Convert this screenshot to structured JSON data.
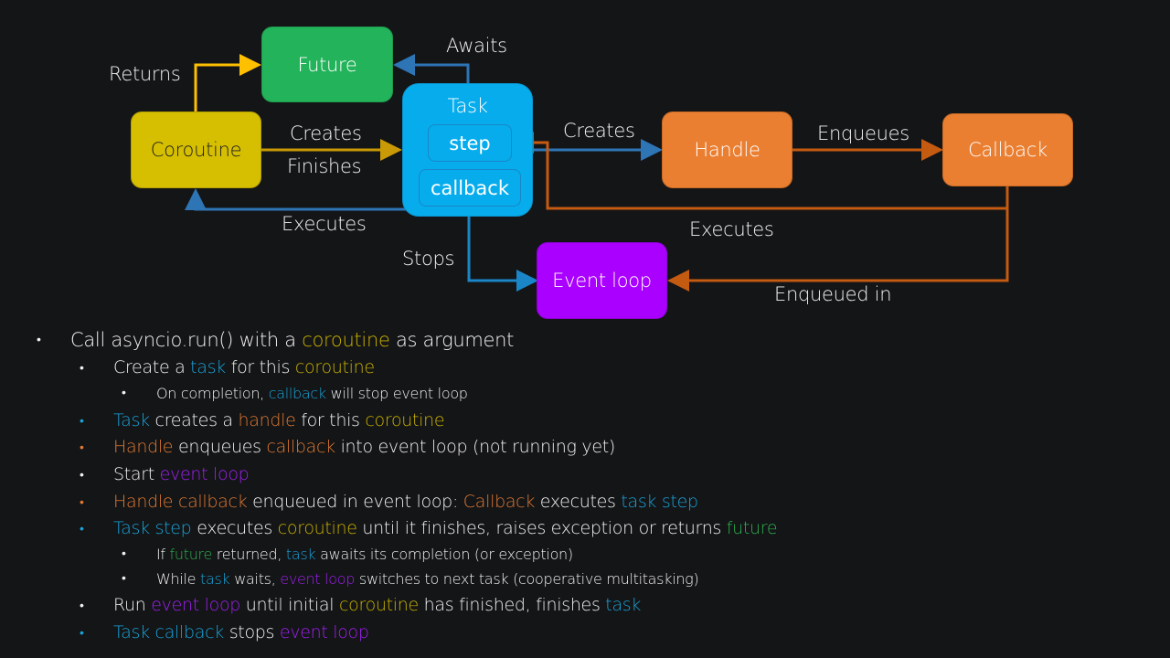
{
  "colors": {
    "coroutine": "#d6bf00",
    "future": "#23b35a",
    "task": "#06acec",
    "handle": "#ea7f31",
    "event_loop": "#aa00ff",
    "arrow_yellow": "#ffc000",
    "arrow_gold": "#c99a06",
    "arrow_blue": "#2e75b6",
    "arrow_orange": "#c55a11",
    "text_coroutine": "#c9b100",
    "text_task": "#1aa3d9",
    "text_handle": "#e07a33",
    "text_event_loop": "#a020f0",
    "text_future": "#2eae4f"
  },
  "nodes": {
    "future": "Future",
    "coroutine": "Coroutine",
    "task": "Task",
    "task_step": "step",
    "task_callback": "callback",
    "handle": "Handle",
    "callback": "Callback",
    "event_loop": "Event loop"
  },
  "edges": {
    "returns": "Returns",
    "awaits": "Awaits",
    "creates_task": "Creates",
    "finishes": "Finishes",
    "executes_coroutine": "Executes",
    "creates_handle": "Creates",
    "enqueues": "Enqueues",
    "executes_step": "Executes",
    "stops": "Stops",
    "enqueued_in": "Enqueued in"
  },
  "bullets": [
    {
      "level": 1,
      "bullet_color": "#f2f2f2",
      "segments": [
        {
          "t": "Call asyncio.run() with a "
        },
        {
          "t": "coroutine",
          "c": "coroutine"
        },
        {
          "t": " as argument"
        }
      ]
    },
    {
      "level": 2,
      "bullet_color": "#f2f2f2",
      "segments": [
        {
          "t": "Create a "
        },
        {
          "t": "task",
          "c": "task"
        },
        {
          "t": " for this "
        },
        {
          "t": "coroutine",
          "c": "coroutine"
        }
      ]
    },
    {
      "level": 3,
      "bullet_color": "#f2f2f2",
      "segments": [
        {
          "t": "On completion, "
        },
        {
          "t": "callback",
          "c": "task"
        },
        {
          "t": " will stop event loop"
        }
      ]
    },
    {
      "level": 2,
      "bullet_color": "#1aa3d9",
      "segments": [
        {
          "t": "Task",
          "c": "task"
        },
        {
          "t": " creates a "
        },
        {
          "t": "handle",
          "c": "handle"
        },
        {
          "t": " for this "
        },
        {
          "t": "coroutine",
          "c": "coroutine"
        }
      ]
    },
    {
      "level": 2,
      "bullet_color": "#e07a33",
      "segments": [
        {
          "t": "Handle",
          "c": "handle"
        },
        {
          "t": " enqueues "
        },
        {
          "t": "callback",
          "c": "handle"
        },
        {
          "t": " into event loop (not running yet)"
        }
      ]
    },
    {
      "level": 2,
      "bullet_color": "#f2f2f2",
      "segments": [
        {
          "t": "Start "
        },
        {
          "t": "event loop",
          "c": "event_loop"
        }
      ]
    },
    {
      "level": 2,
      "bullet_color": "#e07a33",
      "segments": [
        {
          "t": "Handle callback",
          "c": "handle"
        },
        {
          "t": " enqueued in event loop: "
        },
        {
          "t": "Callback",
          "c": "handle"
        },
        {
          "t": " executes "
        },
        {
          "t": "task step",
          "c": "task"
        }
      ]
    },
    {
      "level": 2,
      "bullet_color": "#1aa3d9",
      "segments": [
        {
          "t": "Task step",
          "c": "task"
        },
        {
          "t": " executes "
        },
        {
          "t": "coroutine",
          "c": "coroutine"
        },
        {
          "t": " until it finishes, raises exception or returns "
        },
        {
          "t": "future",
          "c": "future"
        }
      ]
    },
    {
      "level": 3,
      "bullet_color": "#f2f2f2",
      "segments": [
        {
          "t": "If "
        },
        {
          "t": "future",
          "c": "future"
        },
        {
          "t": " returned, "
        },
        {
          "t": "task",
          "c": "task"
        },
        {
          "t": " awaits its completion (or exception)"
        }
      ]
    },
    {
      "level": 3,
      "bullet_color": "#f2f2f2",
      "segments": [
        {
          "t": "While "
        },
        {
          "t": "task",
          "c": "task"
        },
        {
          "t": " waits, "
        },
        {
          "t": "event loop",
          "c": "event_loop"
        },
        {
          "t": " switches to next task (cooperative multitasking)"
        }
      ]
    },
    {
      "level": 2,
      "bullet_color": "#f2f2f2",
      "segments": [
        {
          "t": "Run "
        },
        {
          "t": "event loop",
          "c": "event_loop"
        },
        {
          "t": " until initial "
        },
        {
          "t": "coroutine",
          "c": "coroutine"
        },
        {
          "t": " has finished, finishes "
        },
        {
          "t": "task",
          "c": "task"
        }
      ]
    },
    {
      "level": 2,
      "bullet_color": "#1aa3d9",
      "segments": [
        {
          "t": "Task callback",
          "c": "task"
        },
        {
          "t": " stops "
        },
        {
          "t": "event loop",
          "c": "event_loop"
        }
      ]
    }
  ]
}
